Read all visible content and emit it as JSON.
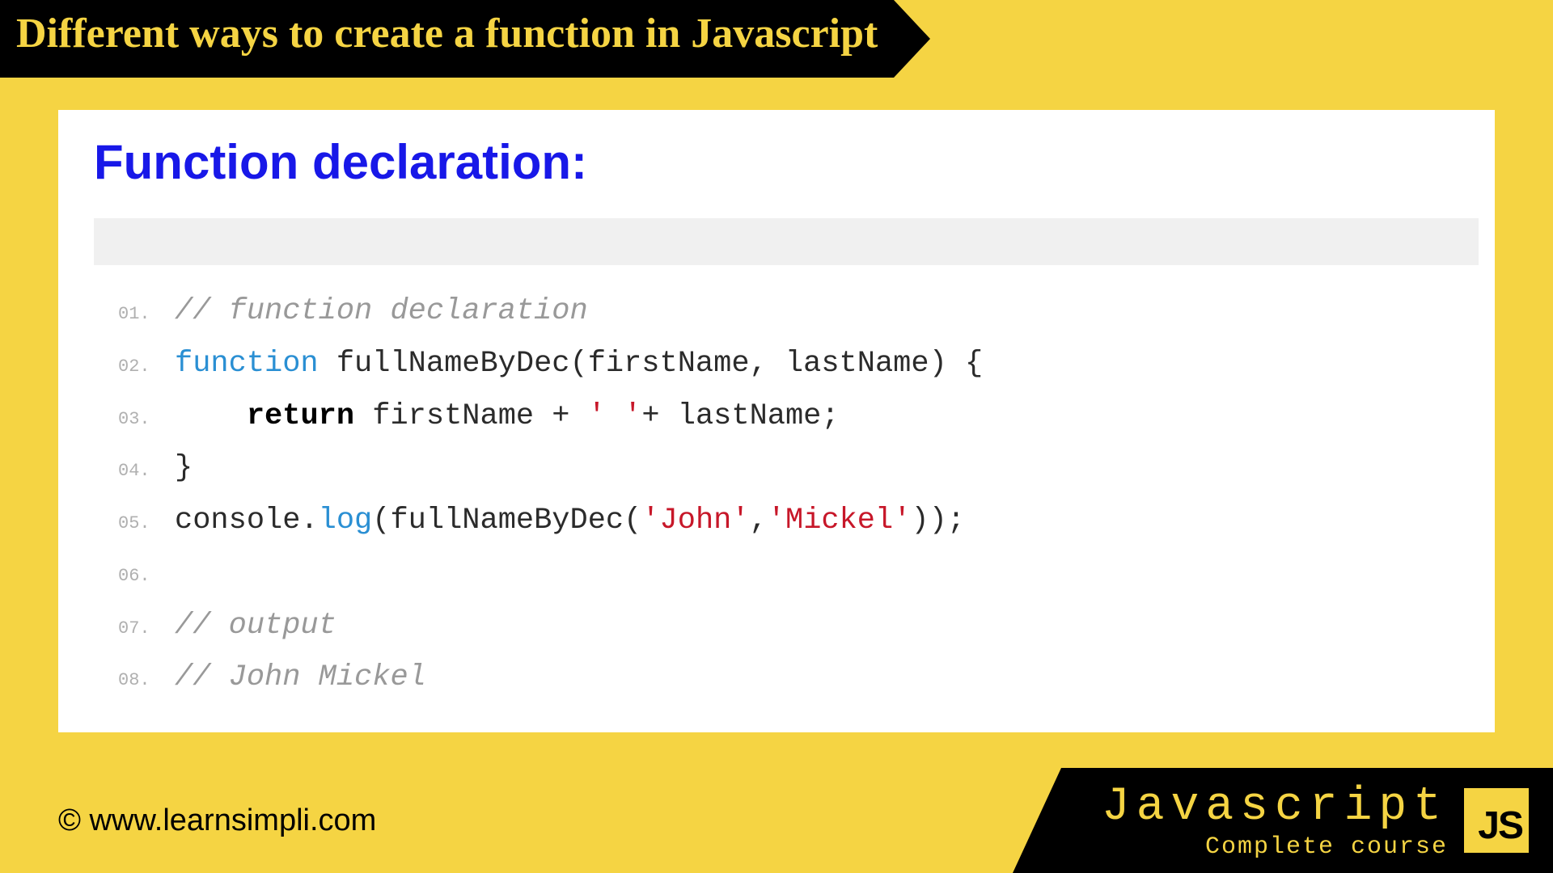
{
  "title": "Different ways to create a function in Javascript",
  "section_heading": "Function declaration:",
  "code": {
    "lines": [
      {
        "num": "01.",
        "tokens": [
          {
            "cls": "comment",
            "text": "// function declaration"
          }
        ]
      },
      {
        "num": "02.",
        "tokens": [
          {
            "cls": "keyword",
            "text": "function"
          },
          {
            "cls": "plain",
            "text": " fullNameByDec(firstName, lastName) {"
          }
        ]
      },
      {
        "num": "03.",
        "tokens": [
          {
            "cls": "plain",
            "text": "    "
          },
          {
            "cls": "keyword-bold",
            "text": "return"
          },
          {
            "cls": "plain",
            "text": " firstName + "
          },
          {
            "cls": "string",
            "text": "' '"
          },
          {
            "cls": "plain",
            "text": "+ lastName;"
          }
        ]
      },
      {
        "num": "04.",
        "tokens": [
          {
            "cls": "plain",
            "text": "}"
          }
        ]
      },
      {
        "num": "05.",
        "tokens": [
          {
            "cls": "plain",
            "text": "console."
          },
          {
            "cls": "method",
            "text": "log"
          },
          {
            "cls": "plain",
            "text": "(fullNameByDec("
          },
          {
            "cls": "string",
            "text": "'John'"
          },
          {
            "cls": "plain",
            "text": ","
          },
          {
            "cls": "string",
            "text": "'Mickel'"
          },
          {
            "cls": "plain",
            "text": "));"
          }
        ]
      },
      {
        "num": "06.",
        "tokens": [
          {
            "cls": "plain",
            "text": " "
          }
        ]
      },
      {
        "num": "07.",
        "tokens": [
          {
            "cls": "comment",
            "text": "// output"
          }
        ]
      },
      {
        "num": "08.",
        "tokens": [
          {
            "cls": "comment",
            "text": "// John Mickel"
          }
        ]
      }
    ]
  },
  "footer": {
    "copyright": "© www.learnsimpli.com",
    "brand_title": "Javascript",
    "brand_sub": "Complete course",
    "logo": "JS"
  }
}
